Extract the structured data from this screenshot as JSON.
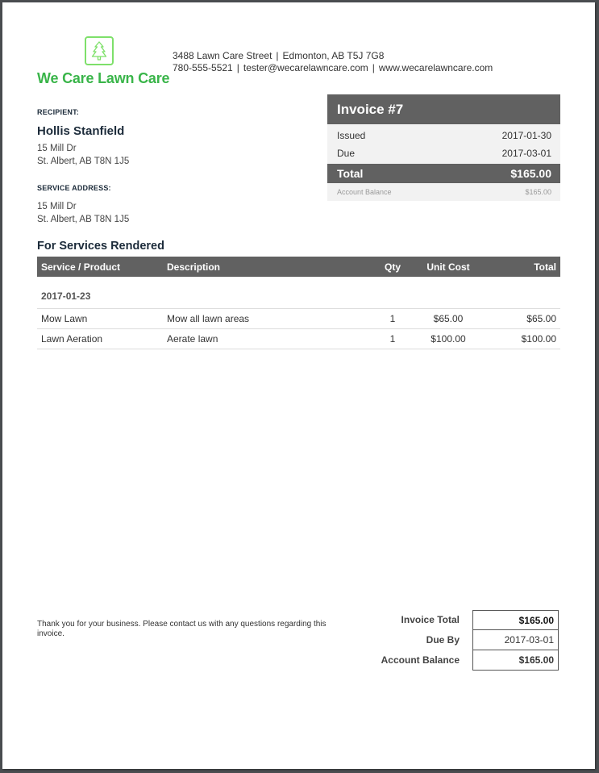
{
  "company": {
    "name": "We Care Lawn Care",
    "logo_icon": "tree-icon",
    "brand_color": "#3ab54a",
    "address_line": "3488 Lawn Care Street",
    "city_line": "Edmonton, AB T5J 7G8",
    "phone": "780-555-5521",
    "email": "tester@wecarelawncare.com",
    "website": "www.wecarelawncare.com",
    "separator": "|"
  },
  "recipient": {
    "label": "RECIPIENT:",
    "name": "Hollis Stanfield",
    "address_line1": "15 Mill Dr",
    "address_line2": "St. Albert, AB T8N 1J5"
  },
  "service_address": {
    "label": "SERVICE ADDRESS:",
    "address_line1": "15 Mill Dr",
    "address_line2": "St. Albert, AB T8N 1J5"
  },
  "invoice": {
    "title": "Invoice #7",
    "issued_label": "Issued",
    "issued": "2017-01-30",
    "due_label": "Due",
    "due": "2017-03-01",
    "total_label": "Total",
    "total": "$165.00",
    "balance_label": "Account Balance",
    "balance": "$165.00"
  },
  "services": {
    "title": "For Services Rendered",
    "columns": [
      "Service / Product",
      "Description",
      "Qty",
      "Unit Cost",
      "Total"
    ],
    "date": "2017-01-23",
    "rows": [
      {
        "service": "Mow Lawn",
        "description": "Mow all lawn areas",
        "qty": "1",
        "unit_cost": "$65.00",
        "total": "$65.00"
      },
      {
        "service": "Lawn Aeration",
        "description": "Aerate lawn",
        "qty": "1",
        "unit_cost": "$100.00",
        "total": "$100.00"
      }
    ]
  },
  "footer": {
    "thanks": "Thank you for your business. Please contact us with any questions regarding this invoice.",
    "totals": [
      {
        "label": "Invoice Total",
        "value": "$165.00"
      },
      {
        "label": "Due By",
        "value": "2017-03-01"
      },
      {
        "label": "Account Balance",
        "value": "$165.00"
      }
    ]
  }
}
